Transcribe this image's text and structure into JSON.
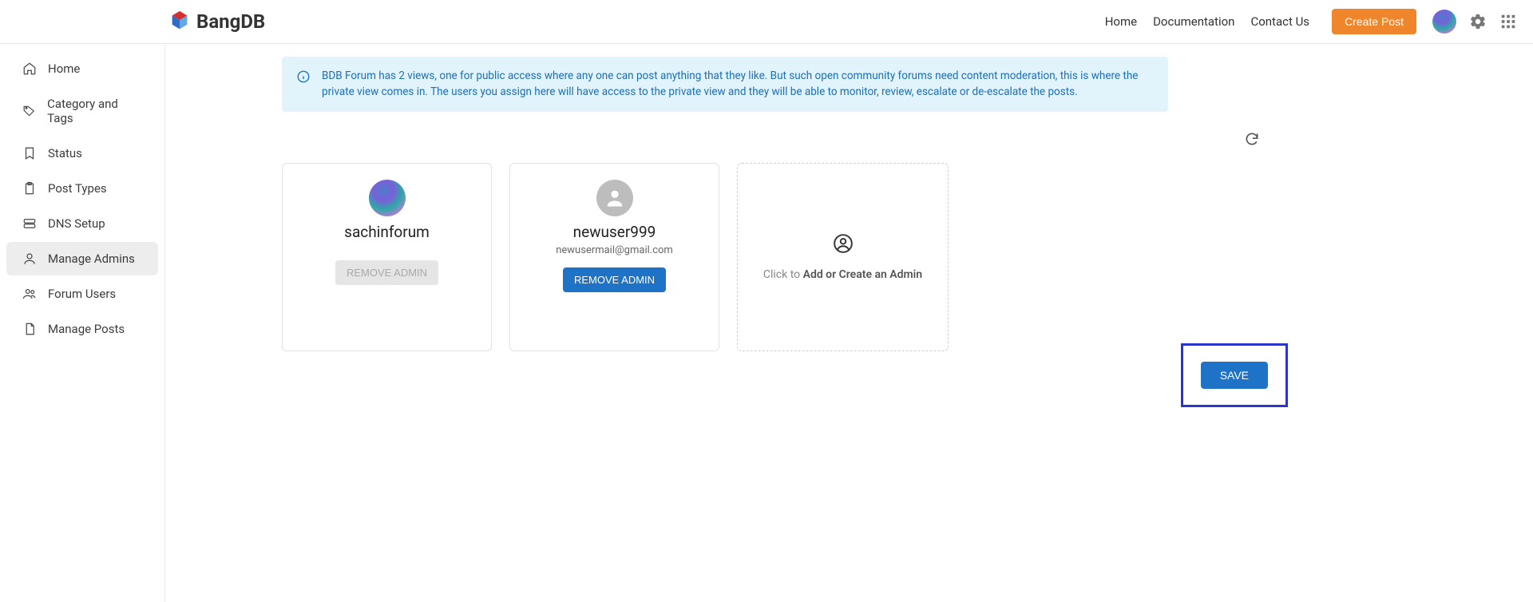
{
  "header": {
    "brand": "BangDB",
    "nav": {
      "home": "Home",
      "documentation": "Documentation",
      "contact": "Contact Us"
    },
    "create_post": "Create Post"
  },
  "sidebar": {
    "items": [
      {
        "label": "Home"
      },
      {
        "label": "Category and Tags"
      },
      {
        "label": "Status"
      },
      {
        "label": "Post Types"
      },
      {
        "label": "DNS Setup"
      },
      {
        "label": "Manage Admins"
      },
      {
        "label": "Forum Users"
      },
      {
        "label": "Manage Posts"
      }
    ]
  },
  "info_text": "BDB Forum has 2 views, one for public access where any one can post anything that they like. But such open community forums need content moderation, this is where the private view comes in. The users you assign here will have access to the private view and they will be able to monitor, review, escalate or de-escalate the posts.",
  "admins": [
    {
      "name": "sachinforum",
      "email": "",
      "remove_label": "REMOVE ADMIN",
      "disabled": true,
      "avatar": "colorful"
    },
    {
      "name": "newuser999",
      "email": "newusermail@gmail.com",
      "remove_label": "REMOVE ADMIN",
      "disabled": false,
      "avatar": "gray"
    }
  ],
  "add_card": {
    "prefix": "Click to ",
    "bold": "Add or Create an Admin"
  },
  "save_label": "SAVE"
}
